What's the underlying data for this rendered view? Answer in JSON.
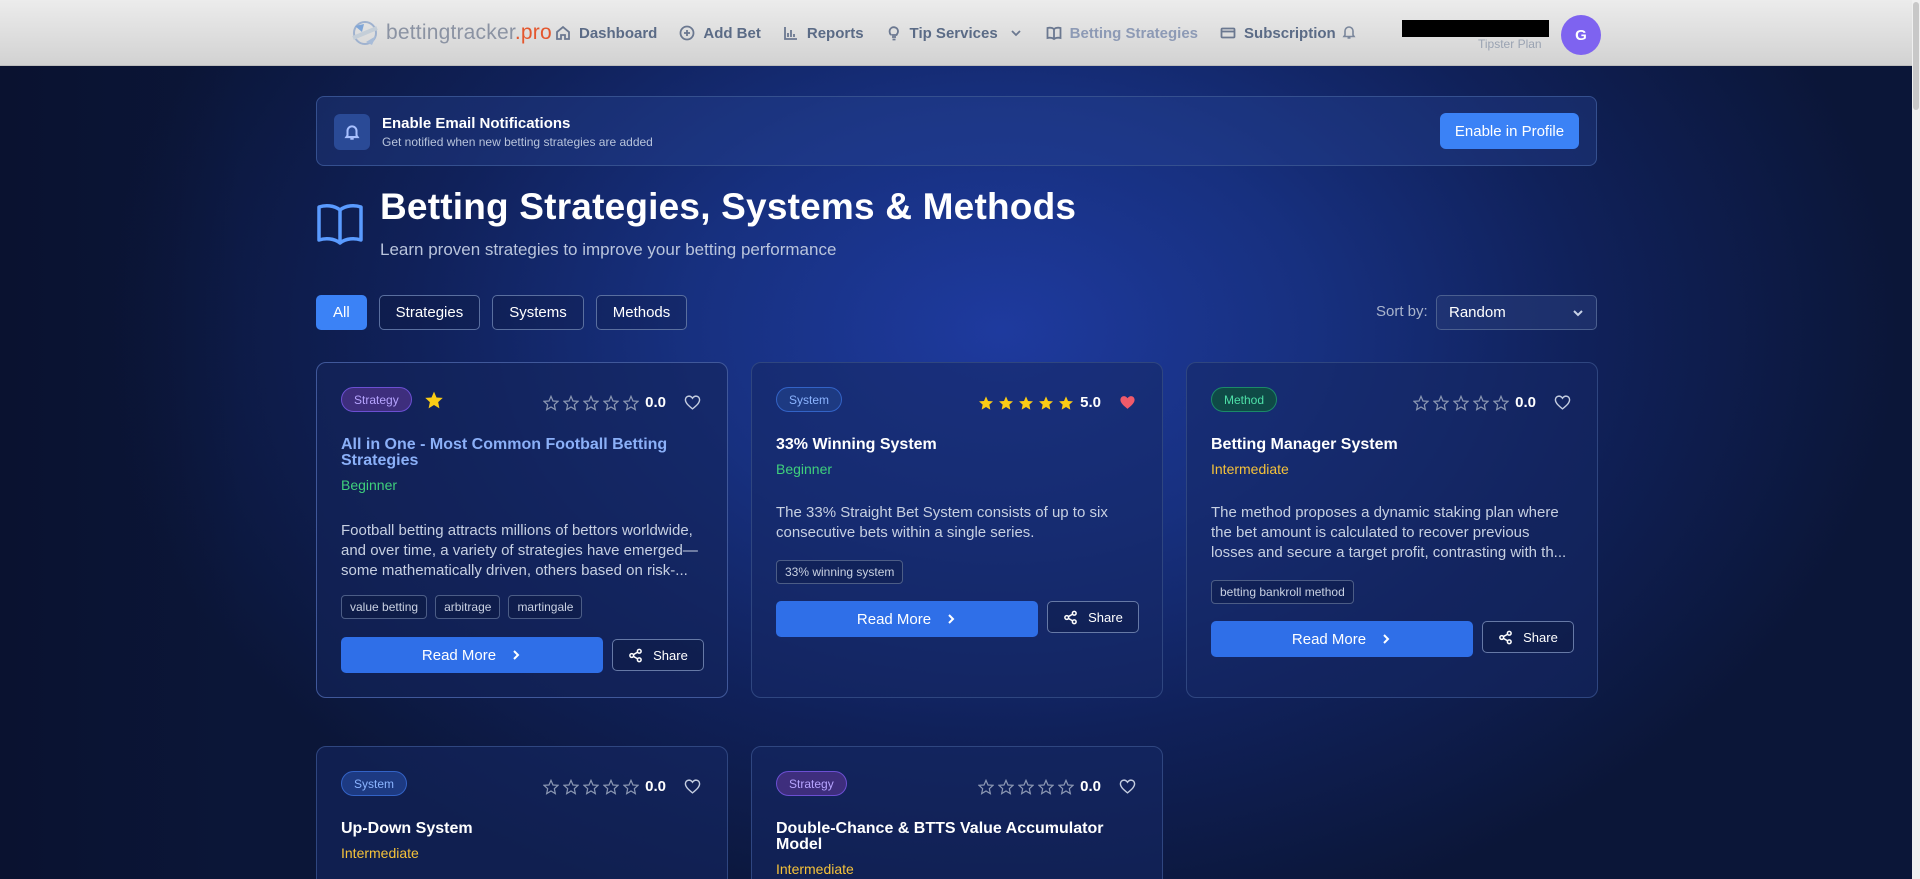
{
  "app": {
    "logo_text": "bettingtracker",
    "logo_suffix": ".pro",
    "plan": "Tipster Plan",
    "avatar_initial": "G"
  },
  "nav": [
    {
      "label": "Dashboard",
      "icon": "home-icon"
    },
    {
      "label": "Add Bet",
      "icon": "plus-circle-icon"
    },
    {
      "label": "Reports",
      "icon": "bar-chart-icon"
    },
    {
      "label": "Tip Services",
      "icon": "lightbulb-icon"
    },
    {
      "label": "Betting Strategies",
      "icon": "book-icon"
    },
    {
      "label": "Subscription",
      "icon": "credit-card-icon"
    }
  ],
  "notice": {
    "title": "Enable Email Notifications",
    "subtitle": "Get notified when new betting strategies are added",
    "button": "Enable in Profile"
  },
  "hero": {
    "title": "Betting Strategies, Systems & Methods",
    "subtitle": "Learn proven strategies to improve your betting performance"
  },
  "filters": [
    "All",
    "Strategies",
    "Systems",
    "Methods"
  ],
  "active_filter": "All",
  "sort": {
    "label": "Sort by:",
    "value": "Random"
  },
  "cards": [
    {
      "type": "Strategy",
      "featured": true,
      "rating": 0,
      "rating_text": "0.0",
      "favorited": false,
      "title": "All in One - Most Common Football Betting Strategies",
      "level": "Beginner",
      "description": "Football betting attracts millions of bettors worldwide, and over time, a variety of strategies have emerged—some mathematically driven, others based on risk-...",
      "tags": [
        "value betting",
        "arbitrage",
        "martingale"
      ],
      "read_more": "Read More",
      "share": "Share"
    },
    {
      "type": "System",
      "featured": false,
      "rating": 5,
      "rating_text": "5.0",
      "favorited": true,
      "title": "33% Winning System",
      "level": "Beginner",
      "description": "The 33% Straight Bet System consists of up to six consecutive bets within a single series.",
      "tags": [
        "33% winning system"
      ],
      "read_more": "Read More",
      "share": "Share"
    },
    {
      "type": "Method",
      "featured": false,
      "rating": 0,
      "rating_text": "0.0",
      "favorited": false,
      "title": "Betting Manager System",
      "level": "Intermediate",
      "description": "The method proposes a dynamic staking plan where the bet amount is calculated to recover previous losses and secure a target profit, contrasting with th...",
      "tags": [
        "betting bankroll method"
      ],
      "read_more": "Read More",
      "share": "Share"
    },
    {
      "type": "System",
      "featured": false,
      "rating": 0,
      "rating_text": "0.0",
      "favorited": false,
      "title": "Up-Down System",
      "level": "Intermediate"
    },
    {
      "type": "Strategy",
      "featured": false,
      "rating": 0,
      "rating_text": "0.0",
      "favorited": false,
      "title": "Double-Chance & BTTS Value Accumulator Model",
      "level": "Intermediate"
    }
  ],
  "colors": {
    "accent": "#3b82f6",
    "beginner": "#3fd07c",
    "intermediate": "#f5c23a",
    "star": "#facc15",
    "heart": "#f05a6a"
  }
}
